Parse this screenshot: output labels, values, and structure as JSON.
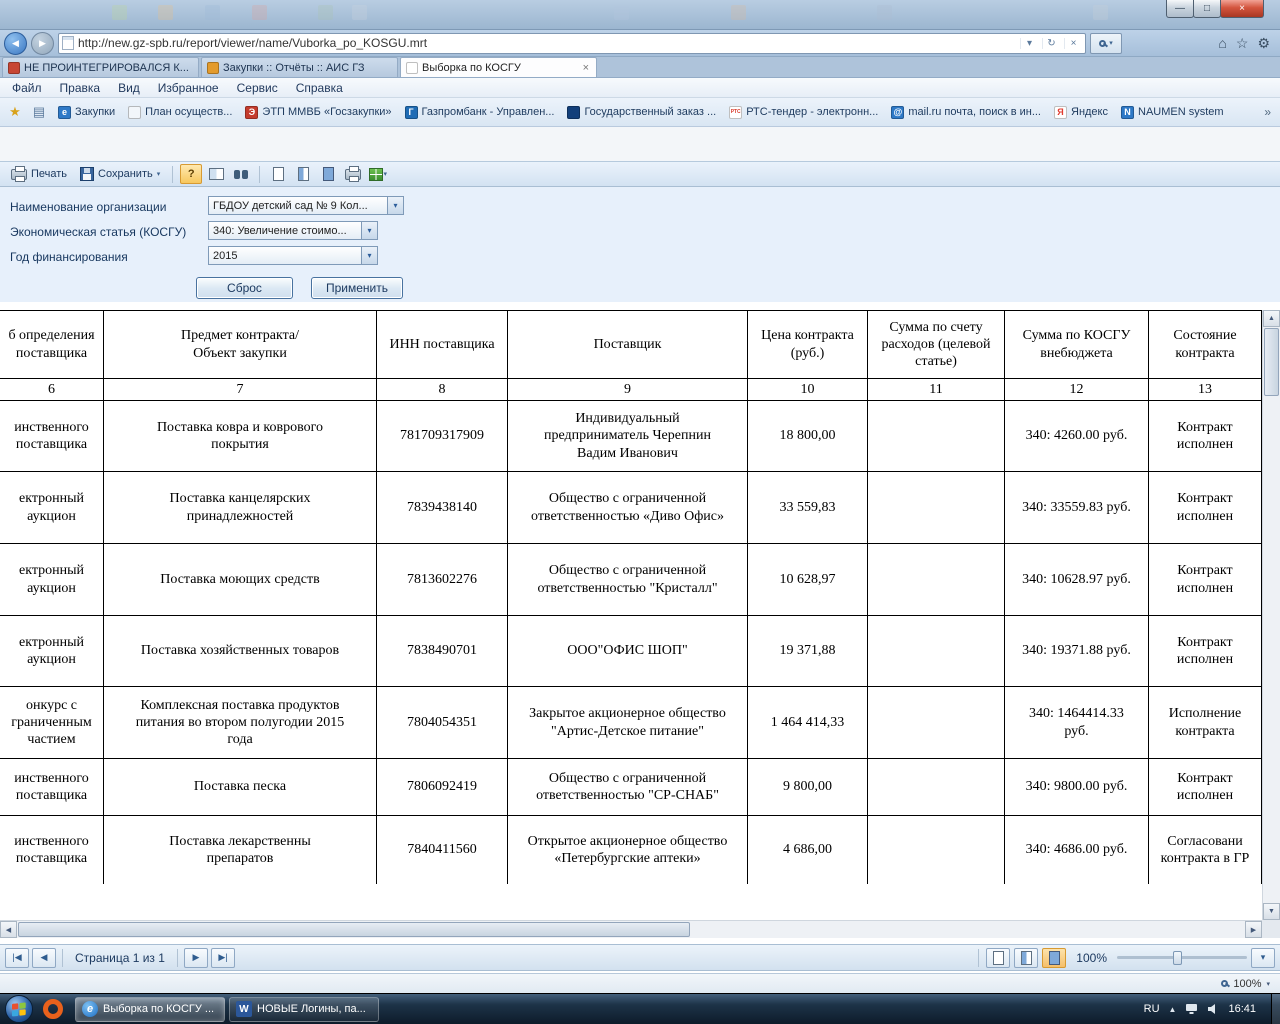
{
  "window": {
    "controls": {
      "minimize": "—",
      "maximize": "□",
      "close": "×"
    }
  },
  "colors": {
    "form_bg": "#e7f0fb",
    "accent_blue": "#2f5c8f",
    "taskbar_bg": "#16293c",
    "selection_orange": "#f5bf6a"
  },
  "browser": {
    "url": "http://new.gz-spb.ru/report/viewer/name/Vuborka_po_KOSGU.mrt",
    "tabs": [
      {
        "label": "НЕ ПРОИНТЕГРИРОВАЛСЯ К...",
        "active": false,
        "icon_bg": "#c74634"
      },
      {
        "label": "Закупки :: Отчёты :: АИС ГЗ",
        "active": false,
        "icon_bg": "#e39b2d"
      },
      {
        "label": "Выборка по КОСГУ",
        "active": true,
        "icon_bg": "#ffffff"
      }
    ],
    "menu": [
      "Файл",
      "Правка",
      "Вид",
      "Избранное",
      "Сервис",
      "Справка"
    ],
    "favorites": [
      {
        "label": "Закупки",
        "icon": "ie-icon",
        "glyph": "e",
        "bg": "#2e79c7",
        "fg": "#ffffff"
      },
      {
        "label": "План осуществ...",
        "icon": "document-icon",
        "glyph": "",
        "bg": "#f2f6fa",
        "fg": "#444444"
      },
      {
        "label": "ЭТП ММВБ «Госзакупки»",
        "icon": "etp-icon",
        "glyph": "Э",
        "bg": "#c43c2e",
        "fg": "#ffffff"
      },
      {
        "label": "Газпромбанк - Управлен...",
        "icon": "bank-icon",
        "glyph": "Г",
        "bg": "#1f6cb5",
        "fg": "#ffffff"
      },
      {
        "label": "Государственный заказ ...",
        "icon": "goszakaz-icon",
        "glyph": "",
        "bg": "#123f7a",
        "fg": "#ffffff"
      },
      {
        "label": "РТС-тендер - электронн...",
        "icon": "rts-icon",
        "glyph": "РТС",
        "bg": "#ffffff",
        "fg": "#d93a2b"
      },
      {
        "label": "mail.ru почта, поиск в ин...",
        "icon": "mail-icon",
        "glyph": "@",
        "bg": "#2e79c7",
        "fg": "#ffffff"
      },
      {
        "label": "Яндекс",
        "icon": "yandex-icon",
        "glyph": "Я",
        "bg": "#ffffff",
        "fg": "#e03c31"
      },
      {
        "label": "NAUMEN system",
        "icon": "naumen-icon",
        "glyph": "N",
        "bg": "#2e79c7",
        "fg": "#ffffff"
      }
    ]
  },
  "report_toolbar": {
    "print": "Печать",
    "save": "Сохранить",
    "help": "?"
  },
  "filters": {
    "rows": [
      {
        "label": "Наименование организации",
        "value": "ГБДОУ детский сад № 9 Кол..."
      },
      {
        "label": "Экономическая статья (КОСГУ)",
        "value": "340: Увеличение стоимо..."
      },
      {
        "label": "Год финансирования",
        "value": "2015"
      }
    ],
    "reset": "Сброс",
    "apply": "Применить"
  },
  "table": {
    "headers": [
      {
        "num": "6",
        "label": "б определения\nпоставщика"
      },
      {
        "num": "7",
        "label": "Предмет контракта/\nОбъект закупки"
      },
      {
        "num": "8",
        "label": "ИНН поставщика"
      },
      {
        "num": "9",
        "label": "Поставщик"
      },
      {
        "num": "10",
        "label": "Цена контракта\n(руб.)"
      },
      {
        "num": "11",
        "label": "Сумма по счету\nрасходов (целевой\nстатье)"
      },
      {
        "num": "12",
        "label": "Сумма по КОСГУ\nвнебюджета"
      },
      {
        "num": "13",
        "label": "Состояние\nконтракта"
      }
    ],
    "rows": [
      {
        "cells": [
          "инственного\nпоставщика",
          "Поставка ковра и коврового\nпокрытия",
          "781709317909",
          "Индивидуальный\nпредприниматель Черепнин\nВадим Иванович",
          "18 800,00",
          "",
          "340: 4260.00 руб.",
          "Контракт\nисполнен"
        ]
      },
      {
        "cells": [
          "ектронный\nаукцион",
          "Поставка канцелярских\nпринадлежностей",
          "7839438140",
          "Общество  с ограниченной\nответственностью «Диво Офис»",
          "33 559,83",
          "",
          "340: 33559.83 руб.",
          "Контракт\nисполнен"
        ]
      },
      {
        "cells": [
          "ектронный\nаукцион",
          "Поставка моющих средств",
          "7813602276",
          "Общество с ограниченной\nответственностью \"Кристалл\"",
          "10 628,97",
          "",
          "340: 10628.97 руб.",
          "Контракт\nисполнен"
        ]
      },
      {
        "cells": [
          "ектронный\nаукцион",
          "Поставка хозяйственных товаров",
          "7838490701",
          "ООО\"ОФИС ШОП\"",
          "19 371,88",
          "",
          "340: 19371.88 руб.",
          "Контракт\nисполнен"
        ]
      },
      {
        "cells": [
          "онкурс с\nграниченным\nчастием",
          "Комплексная поставка продуктов\nпитания во втором полугодии 2015\nгода",
          "7804054351",
          "Закрытое акционерное общество\n\"Артис-Детское питание\"",
          "1 464 414,33",
          "",
          "340: 1464414.33\nруб.",
          "Исполнение\nконтракта"
        ]
      },
      {
        "cells": [
          "инственного\nпоставщика",
          "Поставка песка",
          "7806092419",
          "Общество с ограниченной\nответственностью \"СР-СНАБ\"",
          "9 800,00",
          "",
          "340: 9800.00 руб.",
          "Контракт\nисполнен"
        ]
      },
      {
        "cells": [
          "инственного\nпоставщика",
          "Поставка лекарственны\nпрепаратов",
          "7840411560",
          "Открытое акционерное общество\n«Петербургские аптеки»",
          "4 686,00",
          "",
          "340: 4686.00 руб.",
          "Согласовани\nконтракта в ГР"
        ]
      }
    ]
  },
  "pagination": {
    "first": "|◀",
    "prev": "◀",
    "page_label": "Страница 1 из 1",
    "next": "▶",
    "last": "▶|",
    "zoom": "100%"
  },
  "status": {
    "zoom": "100%"
  },
  "taskbar": {
    "apps": [
      {
        "label": "Выборка по КОСГУ ...",
        "icon": "ie-app-icon",
        "glyph": "e",
        "active": true
      },
      {
        "label": "НОВЫЕ Логины, па...",
        "icon": "word-icon",
        "glyph": "W",
        "active": false
      }
    ],
    "tray": {
      "lang": "RU",
      "time": "16:41"
    }
  }
}
